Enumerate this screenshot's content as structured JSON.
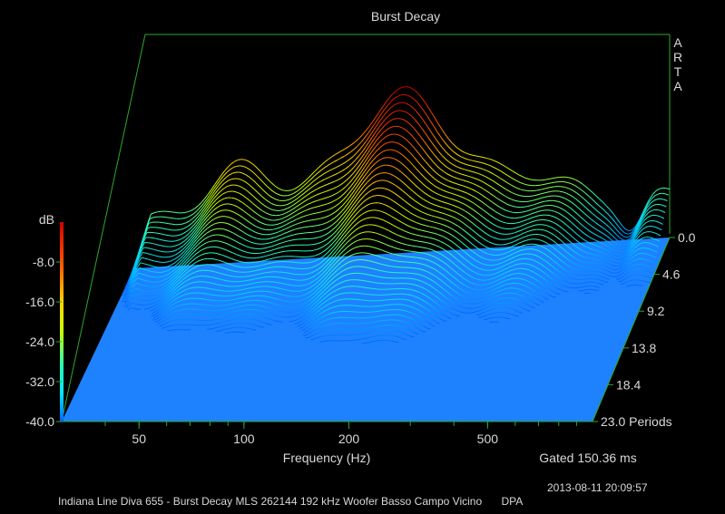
{
  "chart_data": {
    "type": "waterfall",
    "title": "Burst Decay",
    "brand": "ARTA",
    "xlabel": "Frequency (Hz)",
    "x_ticks": [
      "50",
      "100",
      "200",
      "500"
    ],
    "z_unit": "dB",
    "z_ticks": [
      "-8.0",
      "-16.0",
      "-24.0",
      "-32.0",
      "-40.0"
    ],
    "z_range": [
      -40,
      0
    ],
    "y_ticks": [
      "0.0",
      "4.6",
      "9.2",
      "13.8",
      "18.4",
      "23.0 Periods"
    ],
    "y_range": [
      0,
      23
    ],
    "gating": "Gated 150.36 ms",
    "timestamp": "2013-08-11  20:09:57",
    "caption": "Indiana Line Diva 655 - Burst Decay MLS 262144 192 kHz Woofer Basso Campo Vicino",
    "caption_suffix": "DPA",
    "colors": {
      "floor": "#1e82ff",
      "frame": "#2ea82e",
      "background": "#000000"
    }
  }
}
